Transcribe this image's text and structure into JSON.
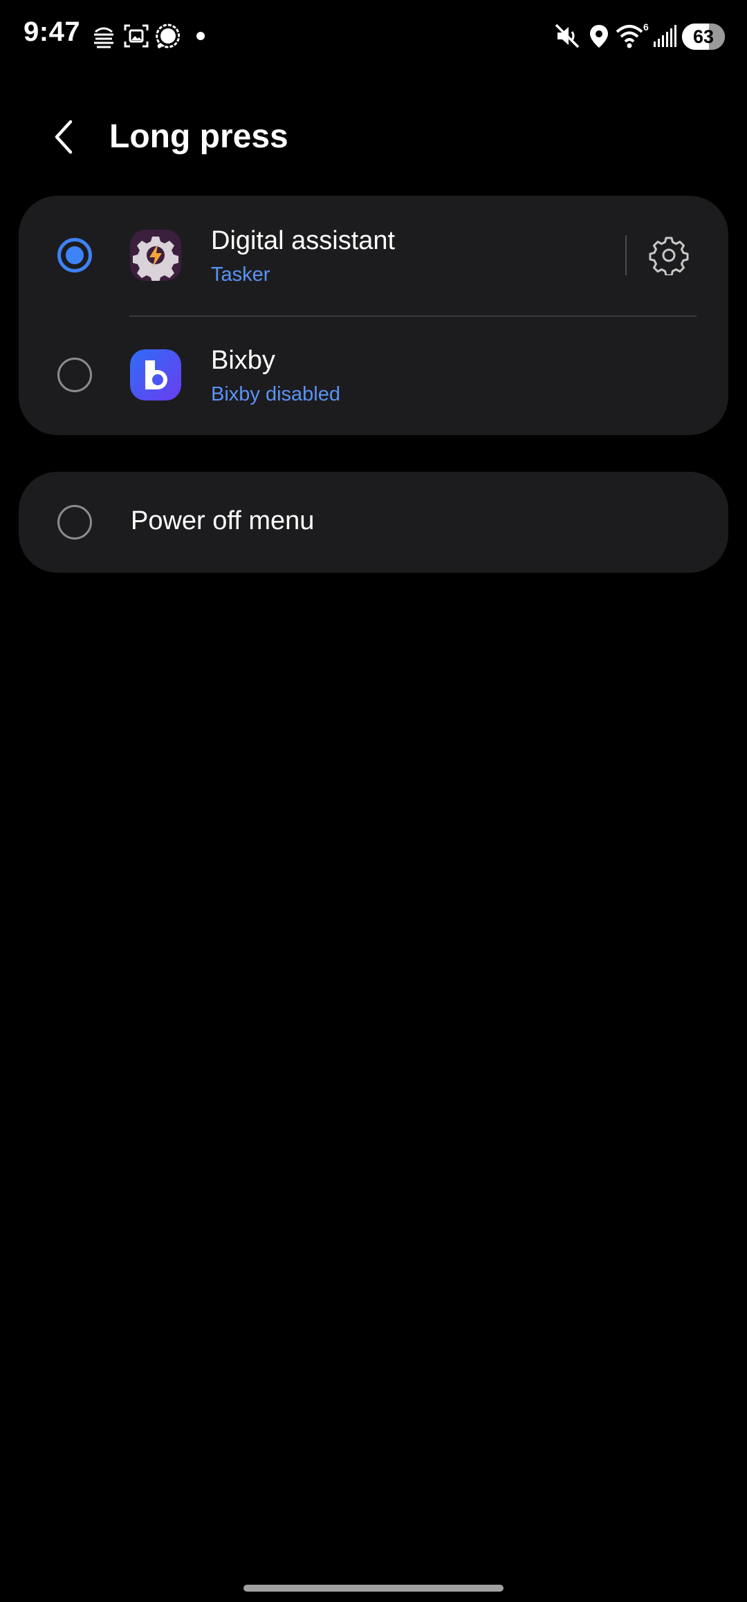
{
  "status_bar": {
    "time": "9:47",
    "battery_level": "63",
    "battery_fraction": 0.63,
    "left_icons": [
      "notification-app-icon",
      "screenshot-icon",
      "signal-messenger-icon",
      "more-dot-icon"
    ],
    "right_icons": [
      "mute-icon",
      "location-icon",
      "wifi-icon",
      "cell-signal-icon",
      "battery-icon"
    ],
    "wifi_badge": "6"
  },
  "header": {
    "back_icon": "chevron-left-icon",
    "title": "Long press"
  },
  "options": [
    {
      "title": "Digital assistant",
      "subtitle": "Tasker",
      "selected": true,
      "icon": "tasker-app-icon",
      "has_settings": true
    },
    {
      "title": "Bixby",
      "subtitle": "Bixby disabled",
      "selected": false,
      "icon": "bixby-app-icon",
      "has_settings": false
    }
  ],
  "power_option": {
    "title": "Power off menu",
    "selected": false
  },
  "colors": {
    "background": "#000000",
    "card": "#1c1c1e",
    "accent": "#3e82f7",
    "subtitle": "#5b93f5"
  }
}
